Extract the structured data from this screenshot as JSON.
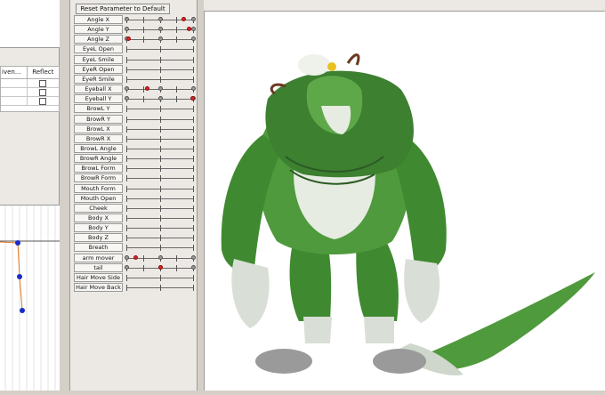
{
  "toolbar": {
    "reset_label": "Reset Parameter to Default"
  },
  "left_table": {
    "col1": "iven...",
    "col2": "Reflect",
    "rows": 3
  },
  "parameters": [
    {
      "label": "Angle X",
      "value": 0.85,
      "active": true
    },
    {
      "label": "Angle Y",
      "value": 0.93,
      "active": true
    },
    {
      "label": "Angle Z",
      "value": 0.02,
      "active": true
    },
    {
      "label": "EyeL Open",
      "value": 1.0,
      "active": false
    },
    {
      "label": "EyeL Smile",
      "value": 0.0,
      "active": false
    },
    {
      "label": "EyeR Open",
      "value": 1.0,
      "active": false
    },
    {
      "label": "EyeR Smile",
      "value": 0.0,
      "active": false
    },
    {
      "label": "Eyeball X",
      "value": 0.3,
      "active": true
    },
    {
      "label": "Eyeball Y",
      "value": 0.98,
      "active": true
    },
    {
      "label": "BrowL Y",
      "value": 0.5,
      "active": false
    },
    {
      "label": "BrowR Y",
      "value": 0.5,
      "active": false
    },
    {
      "label": "BrowL X",
      "value": 0.5,
      "active": false
    },
    {
      "label": "BrowR X",
      "value": 0.5,
      "active": false
    },
    {
      "label": "BrowL Angle",
      "value": 0.5,
      "active": false
    },
    {
      "label": "BrowR Angle",
      "value": 0.5,
      "active": false
    },
    {
      "label": "BrowL Form",
      "value": 0.5,
      "active": false
    },
    {
      "label": "BrowR Form",
      "value": 0.5,
      "active": false
    },
    {
      "label": "Mouth Form",
      "value": 0.5,
      "active": false
    },
    {
      "label": "Mouth Open",
      "value": 0.0,
      "active": false
    },
    {
      "label": "Cheek",
      "value": 0.0,
      "active": false
    },
    {
      "label": "Body X",
      "value": 0.5,
      "active": false
    },
    {
      "label": "Body Y",
      "value": 0.5,
      "active": false
    },
    {
      "label": "Body Z",
      "value": 0.5,
      "active": false
    },
    {
      "label": "Breath",
      "value": 0.0,
      "active": false
    },
    {
      "label": "arm mover",
      "value": 0.13,
      "active": true
    },
    {
      "label": "tail",
      "value": 0.5,
      "active": true
    },
    {
      "label": "Hair Move Side",
      "value": 0.5,
      "active": false
    },
    {
      "label": "Hair Move Back",
      "value": 0.5,
      "active": false
    }
  ],
  "colors": {
    "knob_active": "#e02020",
    "character_green": "#4f9a3c",
    "character_light": "#e6ece2",
    "graph_point": "#1a2cc8",
    "graph_line": "#e07a20"
  }
}
